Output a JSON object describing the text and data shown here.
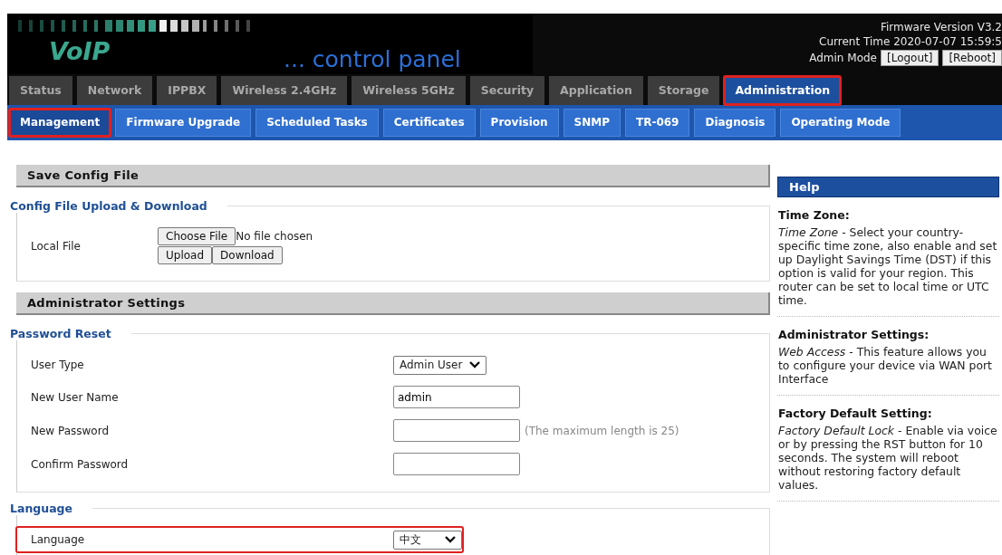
{
  "header": {
    "logo": "VoIP",
    "tagline": "... control panel",
    "firmware": "Firmware Version V3.2",
    "time": "Current Time 2020-07-07 15:59:5",
    "mode": "Admin Mode",
    "buttons": [
      "[Logout]",
      "[Reboot]"
    ]
  },
  "tabs": [
    {
      "label": "Status",
      "selected": false,
      "highlighted": false
    },
    {
      "label": "Network",
      "selected": false,
      "highlighted": false
    },
    {
      "label": "IPPBX",
      "selected": false,
      "highlighted": false
    },
    {
      "label": "Wireless 2.4GHz",
      "selected": false,
      "highlighted": false
    },
    {
      "label": "Wireless 5GHz",
      "selected": false,
      "highlighted": false
    },
    {
      "label": "Security",
      "selected": false,
      "highlighted": false
    },
    {
      "label": "Application",
      "selected": false,
      "highlighted": false
    },
    {
      "label": "Storage",
      "selected": false,
      "highlighted": false
    },
    {
      "label": "Administration",
      "selected": true,
      "highlighted": true
    }
  ],
  "subtabs": [
    {
      "label": "Management",
      "selected": true,
      "highlighted": true
    },
    {
      "label": "Firmware Upgrade",
      "selected": false,
      "highlighted": false
    },
    {
      "label": "Scheduled Tasks",
      "selected": false,
      "highlighted": false
    },
    {
      "label": "Certificates",
      "selected": false,
      "highlighted": false
    },
    {
      "label": "Provision",
      "selected": false,
      "highlighted": false
    },
    {
      "label": "SNMP",
      "selected": false,
      "highlighted": false
    },
    {
      "label": "TR-069",
      "selected": false,
      "highlighted": false
    },
    {
      "label": "Diagnosis",
      "selected": false,
      "highlighted": false
    },
    {
      "label": "Operating Mode",
      "selected": false,
      "highlighted": false
    }
  ],
  "sections": [
    {
      "title": "Save Config File",
      "groups": [
        {
          "title": "Config File Upload & Download",
          "rows": [
            {
              "kind": "file",
              "label": "Local File",
              "choose": "Choose File",
              "status": "No file chosen",
              "buttons": [
                "Upload",
                "Download"
              ],
              "highlighted": false
            }
          ]
        }
      ]
    },
    {
      "title": "Administrator Settings",
      "groups": [
        {
          "title": "Password Reset",
          "rows": [
            {
              "kind": "select",
              "label": "User Type",
              "value": "Admin User",
              "highlighted": false
            },
            {
              "kind": "text",
              "label": "New User Name",
              "value": "admin",
              "highlighted": false
            },
            {
              "kind": "password",
              "label": "New Password",
              "note": "(The maximum length is 25)",
              "highlighted": false
            },
            {
              "kind": "password",
              "label": "Confirm Password",
              "highlighted": false
            }
          ]
        },
        {
          "title": "Language",
          "rows": [
            {
              "kind": "select",
              "label": "Language",
              "value": "中文",
              "highlighted": true
            }
          ]
        }
      ]
    }
  ],
  "help": {
    "title": "Help",
    "items": [
      {
        "heading": "Time Zone:",
        "text": "*Time Zone* - Select your country-specific time zone, also enable and set up Daylight Savings Time (DST) if this option is valid for your region. This router can be set to local time or UTC time."
      },
      {
        "heading": "Administrator Settings:",
        "text": "*Web Access* - This feature allows you to configure your device via WAN port Interface"
      },
      {
        "heading": "Factory Default Setting:",
        "text": "*Factory Default Lock* - Enable via voice or by pressing the RST button for 10 seconds. The system will reboot without restoring factory default values."
      }
    ]
  }
}
